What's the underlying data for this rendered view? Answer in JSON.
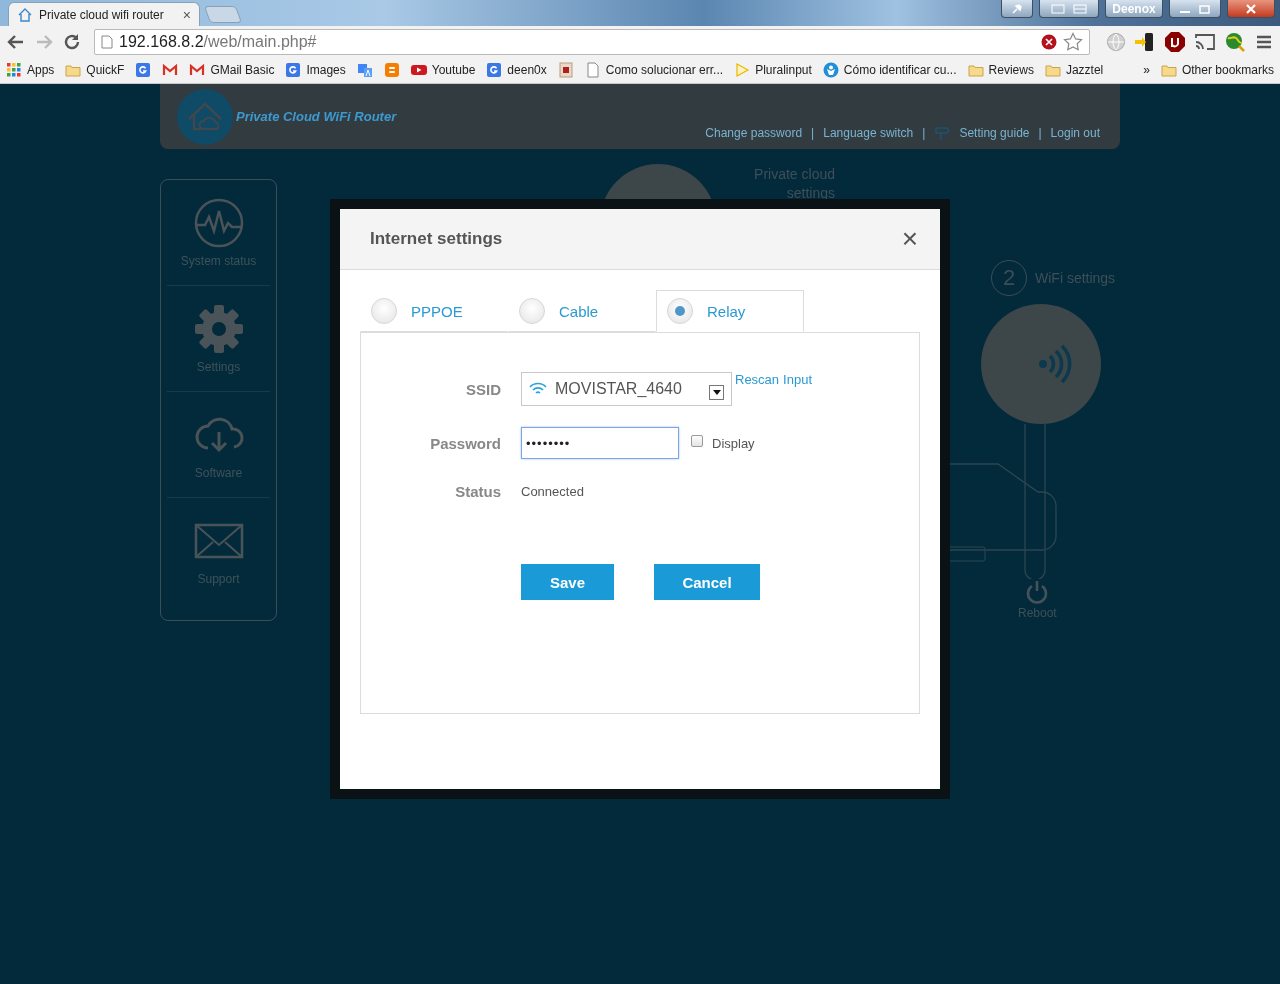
{
  "browser": {
    "tab": {
      "title": "Private cloud wifi router",
      "close": "×"
    },
    "user": "Deenox",
    "address": {
      "host": "192.168.8.2",
      "path": "/web/main.php#"
    },
    "bookmarks": [
      {
        "kind": "apps",
        "label": "Apps"
      },
      {
        "kind": "folder",
        "label": "QuickF"
      },
      {
        "kind": "google"
      },
      {
        "kind": "gmail"
      },
      {
        "kind": "gmail",
        "label": "GMail Basic"
      },
      {
        "kind": "google",
        "label": "Images"
      },
      {
        "kind": "translate"
      },
      {
        "kind": "blogger"
      },
      {
        "kind": "youtube",
        "label": "Youtube"
      },
      {
        "kind": "google",
        "label": "deen0x"
      },
      {
        "kind": "pdf"
      },
      {
        "kind": "page",
        "label": "Como solucionar err..."
      },
      {
        "kind": "play",
        "label": "Pluralinput"
      },
      {
        "kind": "person",
        "label": "Cómo identificar cu..."
      },
      {
        "kind": "folder",
        "label": "Reviews"
      },
      {
        "kind": "folder",
        "label": "Jazztel"
      }
    ],
    "more": "»",
    "other": {
      "kind": "folder",
      "label": "Other bookmarks"
    }
  },
  "header": {
    "brand": "Private Cloud WiFi Router",
    "separator": "|",
    "links": [
      {
        "label": "Change password"
      },
      {
        "label": "Language switch"
      },
      {
        "label": "Setting guide",
        "kind": "signpost"
      },
      {
        "label": "Login out"
      }
    ]
  },
  "sidebar": [
    {
      "kind": "pulse",
      "label": "System status"
    },
    {
      "kind": "gear",
      "label": "Settings"
    },
    {
      "kind": "cloud",
      "label": "Software"
    },
    {
      "kind": "mail",
      "label": "Support"
    }
  ],
  "private_cloud": {
    "label": "Private cloud settings"
  },
  "wifi_step": {
    "number": "2",
    "label": "WiFi settings"
  },
  "reboot": {
    "label": "Reboot"
  },
  "dialog": {
    "title": "Internet settings",
    "close": "×",
    "tabs": [
      {
        "label": "PPPOE",
        "selected": false
      },
      {
        "label": "Cable",
        "selected": false
      },
      {
        "label": "Relay",
        "selected": true
      }
    ],
    "fields": [
      {
        "kind": "select",
        "label": "SSID",
        "value": "MOVISTAR_4640",
        "links": [
          "Rescan",
          "Input"
        ]
      },
      {
        "kind": "password",
        "label": "Password",
        "value": "••••••••",
        "focused": true,
        "checkbox": {
          "label": "Display",
          "checked": false
        }
      },
      {
        "kind": "text",
        "label": "Status",
        "value": "Connected"
      }
    ],
    "buttons": [
      "Save",
      "Cancel"
    ]
  }
}
